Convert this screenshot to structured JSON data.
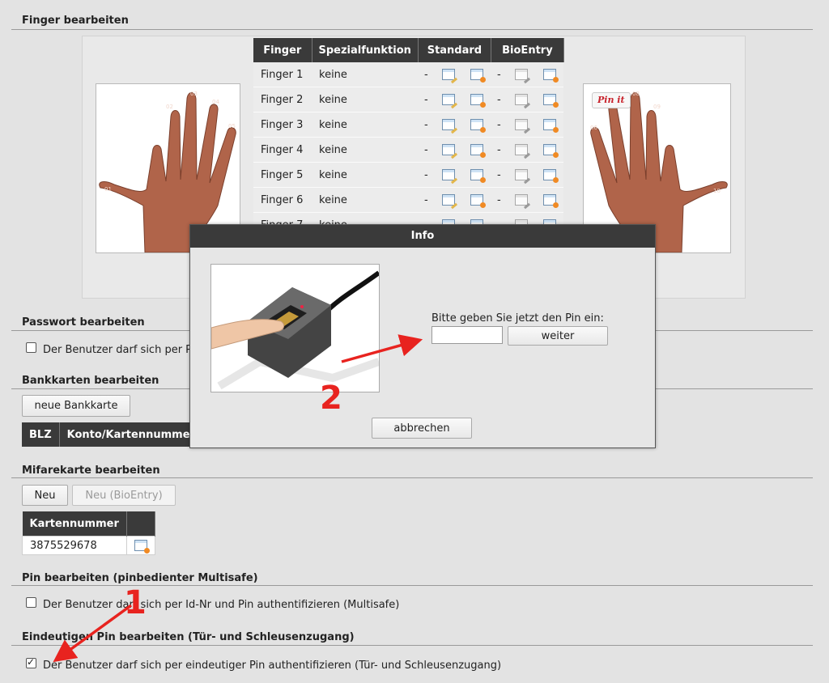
{
  "finger_section": {
    "title": "Finger bearbeiten",
    "table": {
      "headers": [
        "Finger",
        "Spezialfunktion",
        "Standard",
        "BioEntry"
      ],
      "rows": [
        {
          "finger": "Finger 1",
          "spezial": "keine",
          "standard_dash": "-",
          "bio_dash": "-"
        },
        {
          "finger": "Finger 2",
          "spezial": "keine",
          "standard_dash": "-",
          "bio_dash": "-"
        },
        {
          "finger": "Finger 3",
          "spezial": "keine",
          "standard_dash": "-",
          "bio_dash": "-"
        },
        {
          "finger": "Finger 4",
          "spezial": "keine",
          "standard_dash": "-",
          "bio_dash": "-"
        },
        {
          "finger": "Finger 5",
          "spezial": "keine",
          "standard_dash": "-",
          "bio_dash": "-"
        },
        {
          "finger": "Finger 6",
          "spezial": "keine",
          "standard_dash": "-",
          "bio_dash": "-"
        },
        {
          "finger": "Finger 7",
          "spezial": "keine",
          "standard_dash": "-",
          "bio_dash": "-"
        }
      ]
    },
    "left_hand_labels": [
      "01",
      "02",
      "03",
      "04",
      "05"
    ],
    "right_hand_labels": [
      "06",
      "07",
      "08",
      "09",
      "10"
    ],
    "pinit_label": "Pin it"
  },
  "password_section": {
    "title": "Passwort bearbeiten",
    "checkbox_label": "Der Benutzer darf sich per P"
  },
  "bankcard_section": {
    "title": "Bankkarten bearbeiten",
    "new_button": "neue Bankkarte",
    "headers": [
      "BLZ",
      "Konto/Kartennumme"
    ]
  },
  "mifare_section": {
    "title": "Mifarekarte bearbeiten",
    "new_button": "Neu",
    "new_bio_button": "Neu (BioEntry)",
    "headers": [
      "Kartennummer",
      ""
    ],
    "rows": [
      {
        "number": "3875529678"
      }
    ]
  },
  "pin_section": {
    "title": "Pin bearbeiten (pinbedienter Multisafe)",
    "checkbox_label": "Der Benutzer darf sich per Id-Nr und Pin authentifizieren (Multisafe)",
    "checked": false
  },
  "unique_pin_section": {
    "title": "Eindeutigen Pin bearbeiten (Tür- und Schleusenzugang)",
    "checkbox_label": "Der Benutzer darf sich per eindeutiger Pin authentifizieren (Tür- und Schleusenzugang)",
    "checked": true
  },
  "dialog": {
    "title": "Info",
    "prompt": "Bitte geben Sie jetzt den Pin ein:",
    "pin_value": "",
    "continue_button": "weiter",
    "cancel_button": "abbrechen"
  },
  "annotations": {
    "marker_1": "1",
    "marker_2": "2",
    "color": "#e8231f"
  },
  "colors": {
    "header_bg": "#3a3a3a",
    "page_bg": "#e3e3e3"
  }
}
